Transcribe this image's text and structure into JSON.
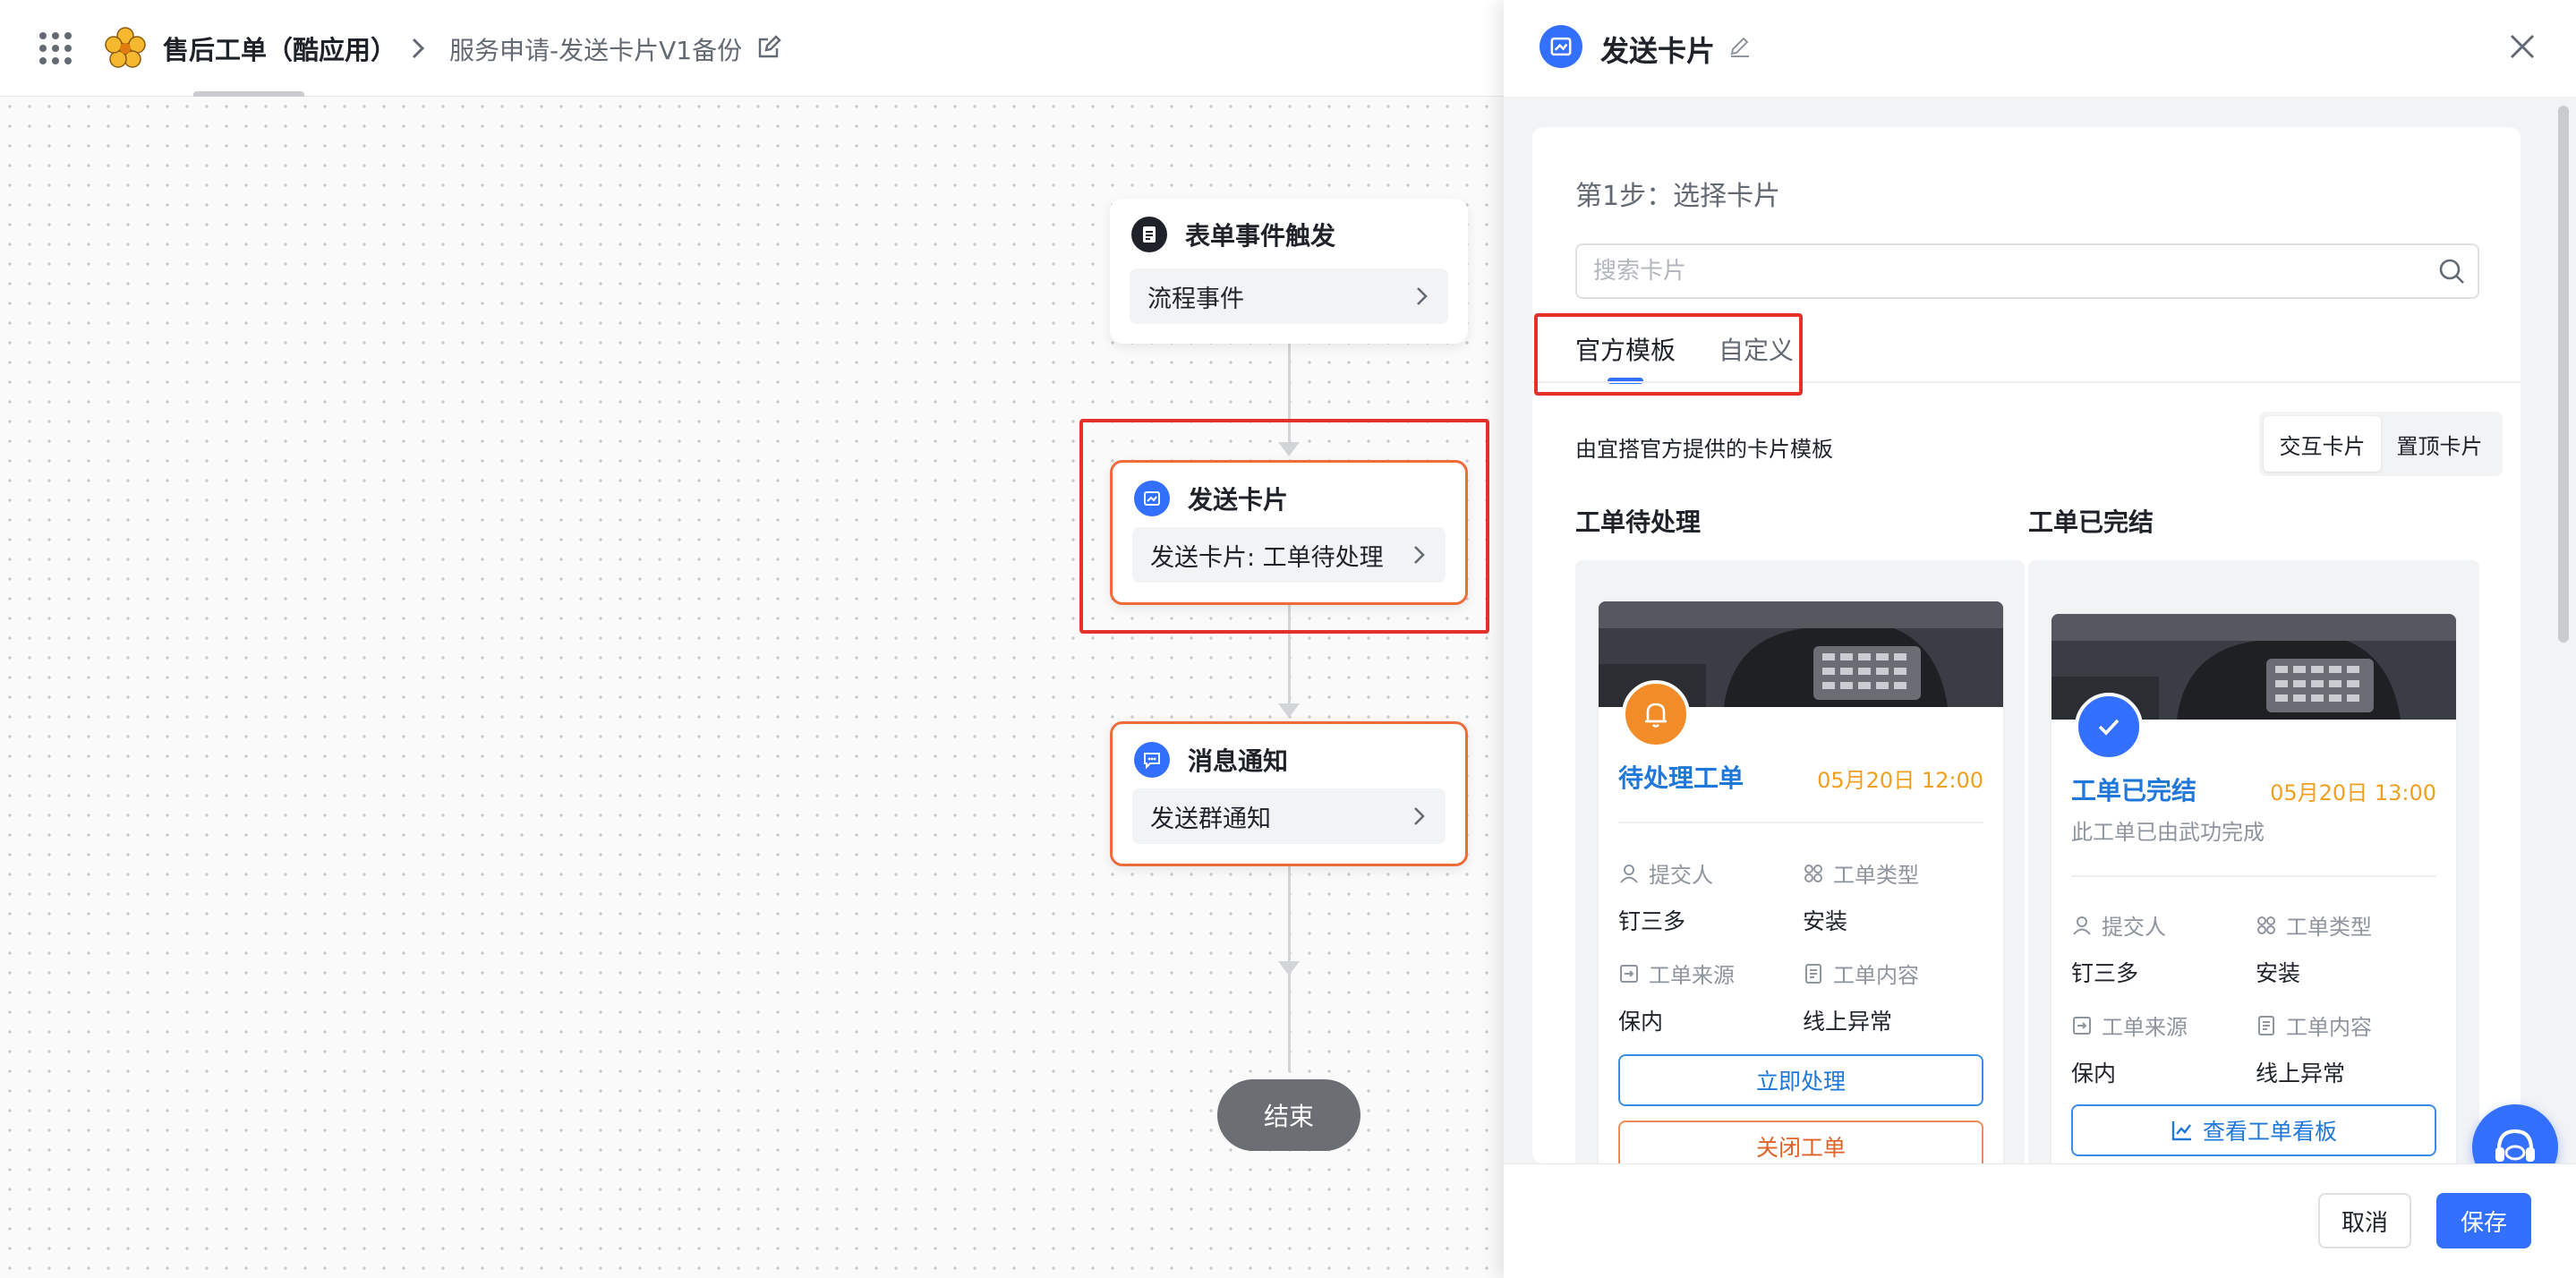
{
  "app": {
    "title": "售后工单（酷应用）",
    "breadcrumb": "服务申请-发送卡片V1备份",
    "tooltip": "售后工单（酷应用）"
  },
  "flow": {
    "nodes": [
      {
        "title": "表单事件触发",
        "body": "流程事件"
      },
      {
        "title": "发送卡片",
        "body": "发送卡片: 工单待处理"
      },
      {
        "title": "消息通知",
        "body": "发送群通知"
      }
    ],
    "end_label": "结束"
  },
  "panel": {
    "title": "发送卡片",
    "step_title": "第1步：选择卡片",
    "search_placeholder": "搜索卡片",
    "tabs": [
      {
        "label": "官方模板",
        "active": true
      },
      {
        "label": "自定义",
        "active": false
      }
    ],
    "description": "由宜搭官方提供的卡片模板",
    "segments": [
      {
        "label": "交互卡片",
        "active": true
      },
      {
        "label": "置顶卡片",
        "active": false
      }
    ],
    "templates": [
      {
        "column_title": "工单待处理",
        "card_name": "待处理工单",
        "time": "05月20日 12:00",
        "fields": [
          {
            "icon": "user-icon",
            "label": "提交人",
            "value": "钉三多"
          },
          {
            "icon": "grid-icon",
            "label": "工单类型",
            "value": "安装"
          },
          {
            "icon": "login-icon",
            "label": "工单来源",
            "value": "保内"
          },
          {
            "icon": "doc-icon",
            "label": "工单内容",
            "value": "线上异常"
          }
        ],
        "buttons": [
          "立即处理",
          "关闭工单"
        ]
      },
      {
        "column_title": "工单已完结",
        "card_name": "工单已完结",
        "time": "05月20日 13:00",
        "subtitle": "此工单已由武功完成",
        "fields": [
          {
            "icon": "user-icon",
            "label": "提交人",
            "value": "钉三多"
          },
          {
            "icon": "grid-icon",
            "label": "工单类型",
            "value": "安装"
          },
          {
            "icon": "login-icon",
            "label": "工单来源",
            "value": "保内"
          },
          {
            "icon": "doc-icon",
            "label": "工单内容",
            "value": "线上异常"
          }
        ],
        "buttons": [
          "查看工单看板"
        ]
      }
    ],
    "cancel_label": "取消",
    "save_label": "保存"
  },
  "colors": {
    "accent": "#3370ff",
    "highlight_red": "#e5312b",
    "node_border_orange": "#ef6b3a",
    "time_orange": "#f0a020"
  }
}
